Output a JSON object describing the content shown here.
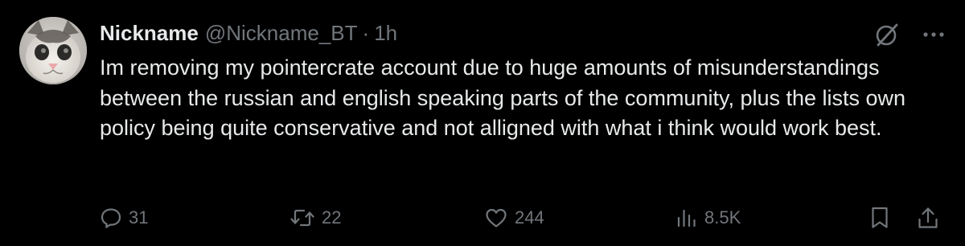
{
  "tweet": {
    "display_name": "Nickname",
    "handle": "@Nickname_BT",
    "separator": "·",
    "time": "1h",
    "body": "Im removing my pointercrate account due to huge amounts of misunderstandings between the russian and english speaking parts of the community, plus the lists own policy being quite conservative and not alligned with what i think would work best.",
    "avatar_icon": "cat-avatar"
  },
  "actions": {
    "reply_count": "31",
    "retweet_count": "22",
    "like_count": "244",
    "views_count": "8.5K"
  },
  "icons": {
    "grok": "grok-icon",
    "more": "more-icon",
    "reply": "reply-icon",
    "retweet": "retweet-icon",
    "like": "like-icon",
    "views": "views-icon",
    "bookmark": "bookmark-icon",
    "share": "share-icon"
  },
  "colors": {
    "background": "#000000",
    "primary_text": "#e7e9ea",
    "secondary_text": "#71767b"
  }
}
